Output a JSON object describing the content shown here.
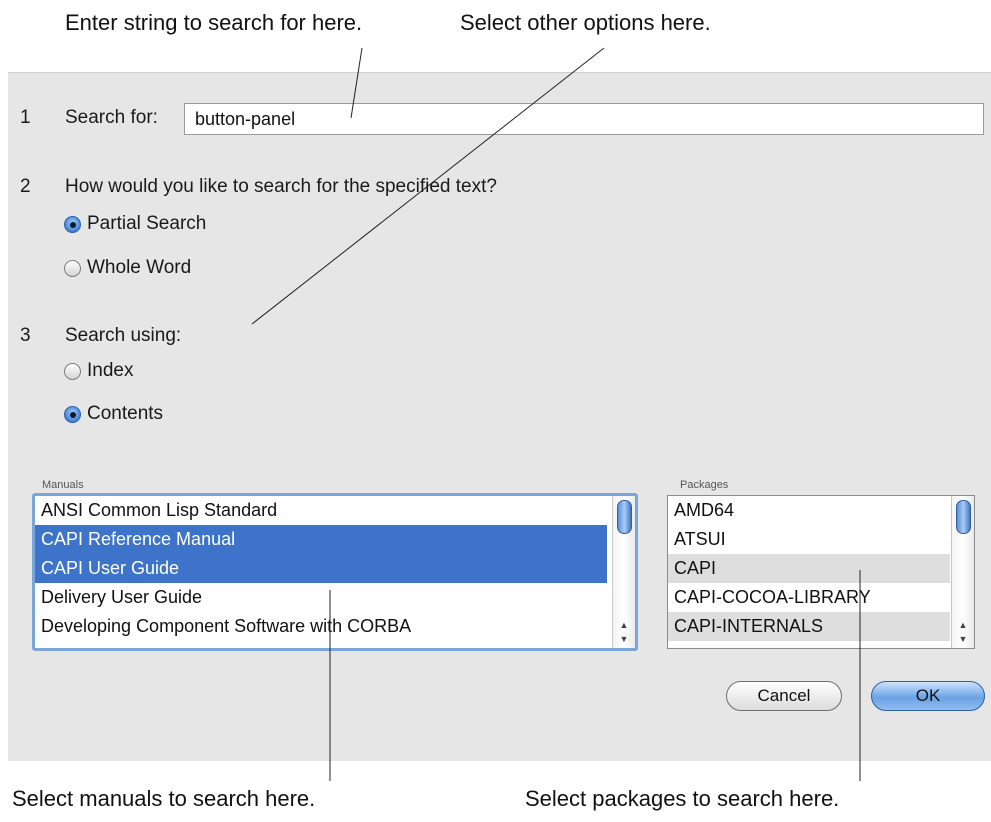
{
  "callouts": {
    "search": "Enter string to search for here.",
    "options": "Select other options here.",
    "manuals": "Select manuals to search here.",
    "packages": "Select packages to search here."
  },
  "step1": {
    "num": "1",
    "label": "Search for:",
    "value": "button-panel"
  },
  "step2": {
    "num": "2",
    "label": "How would you like to search for the specified text?",
    "options": [
      {
        "label": "Partial Search",
        "selected": true
      },
      {
        "label": "Whole Word",
        "selected": false
      }
    ]
  },
  "step3": {
    "num": "3",
    "label": "Search using:",
    "options": [
      {
        "label": "Index",
        "selected": false
      },
      {
        "label": "Contents",
        "selected": true
      }
    ]
  },
  "manuals": {
    "label": "Manuals",
    "items": [
      {
        "label": "ANSI Common Lisp Standard",
        "selected": false
      },
      {
        "label": "CAPI Reference Manual",
        "selected": true
      },
      {
        "label": "CAPI User Guide",
        "selected": true
      },
      {
        "label": "Delivery User Guide",
        "selected": false
      },
      {
        "label": "Developing Component Software with CORBA",
        "selected": false
      }
    ]
  },
  "packages": {
    "label": "Packages",
    "items": [
      {
        "label": "AMD64",
        "selected": false
      },
      {
        "label": "ATSUI",
        "selected": false
      },
      {
        "label": "CAPI",
        "selected": false
      },
      {
        "label": "CAPI-COCOA-LIBRARY",
        "selected": false
      },
      {
        "label": "CAPI-INTERNALS",
        "selected": false
      }
    ]
  },
  "buttons": {
    "cancel": "Cancel",
    "ok": "OK"
  },
  "colors": {
    "selection": "#3d74c9",
    "dialog_bg": "#e6e6e6",
    "default_button": "#6aa3e6"
  },
  "icons": {
    "scroll_up": "scroll-up-arrow-icon",
    "scroll_down": "scroll-down-arrow-icon"
  }
}
